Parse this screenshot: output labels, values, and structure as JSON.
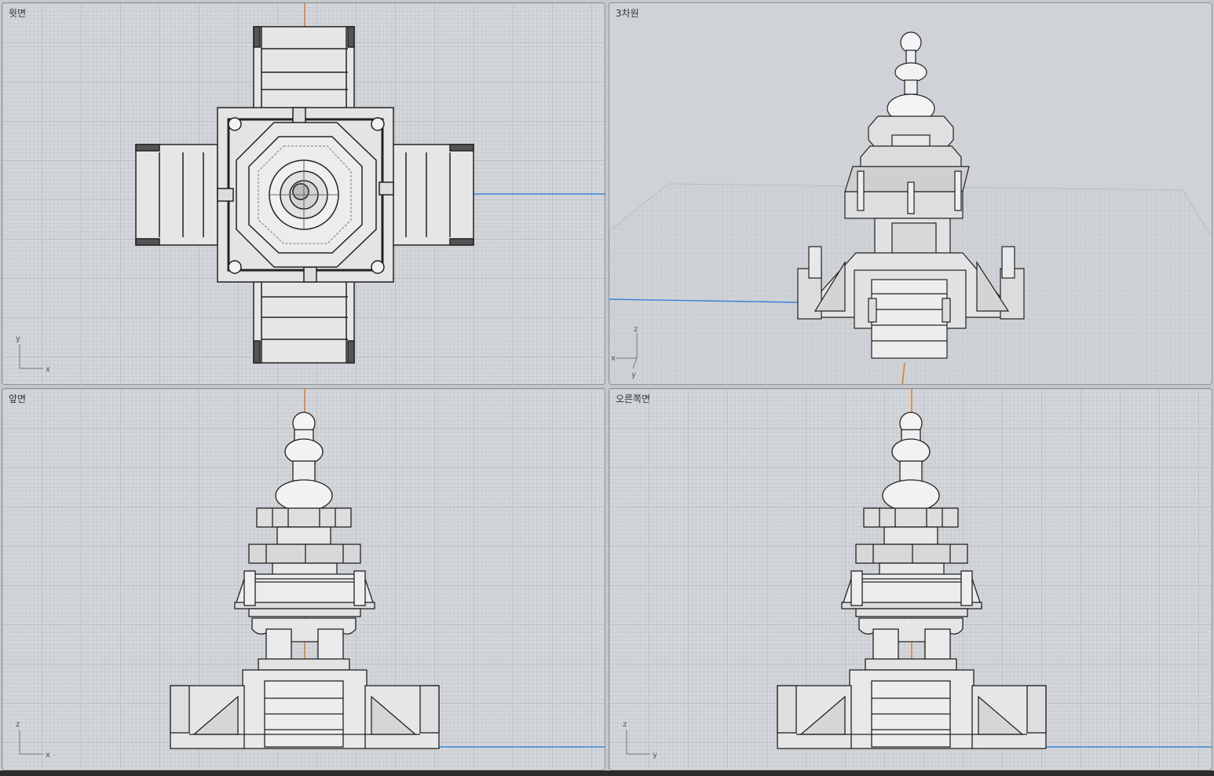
{
  "viewports": {
    "top": {
      "label": "윗면",
      "axis_h": "x",
      "axis_v": "y"
    },
    "persp": {
      "label": "3차원",
      "axis_h": "x",
      "axis_v": "z",
      "axis_d": "y"
    },
    "front": {
      "label": "앞면",
      "axis_h": "x",
      "axis_v": "z"
    },
    "right": {
      "label": "오른쪽면",
      "axis_h": "y",
      "axis_v": "z"
    }
  },
  "colors": {
    "grid_bg": "#d3d7db",
    "x_axis": "#3a86d9",
    "y_axis": "#e07a1f",
    "model_fill": "#e8e8e8",
    "model_stroke": "#222222"
  },
  "icons": {
    "gizmo": "axis-gizmo-icon"
  }
}
